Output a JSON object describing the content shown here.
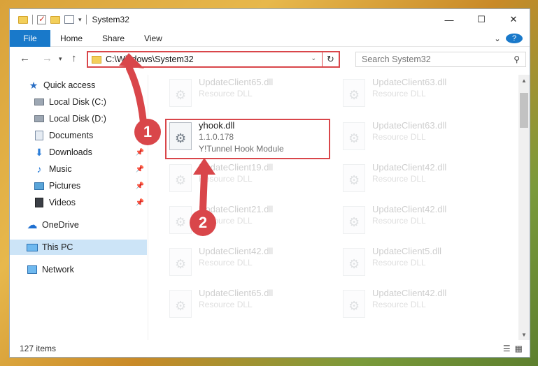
{
  "window": {
    "title": "System32"
  },
  "ribbon": {
    "tabs": [
      "File",
      "Home",
      "Share",
      "View"
    ]
  },
  "address": {
    "path": "C:\\Windows\\System32"
  },
  "search": {
    "placeholder": "Search System32"
  },
  "sidebar": {
    "items": [
      {
        "label": "Quick access",
        "icon": "star-icon"
      },
      {
        "label": "Local Disk (C:)",
        "icon": "drive-icon"
      },
      {
        "label": "Local Disk (D:)",
        "icon": "drive-icon"
      },
      {
        "label": "Documents",
        "icon": "documents-icon"
      },
      {
        "label": "Downloads",
        "icon": "download-icon",
        "pinned": true
      },
      {
        "label": "Music",
        "icon": "music-icon",
        "pinned": true
      },
      {
        "label": "Pictures",
        "icon": "pictures-icon",
        "pinned": true
      },
      {
        "label": "Videos",
        "icon": "videos-icon",
        "pinned": true
      },
      {
        "label": "OneDrive",
        "icon": "cloud-icon"
      },
      {
        "label": "This PC",
        "icon": "computer-icon",
        "selected": true
      },
      {
        "label": "Network",
        "icon": "network-icon"
      }
    ]
  },
  "files": {
    "left": [
      {
        "name": "UpdateClient65.dll",
        "type": "Resource DLL"
      },
      {
        "name": "yhook.dll",
        "version": "1.1.0.178",
        "description": "Y!Tunnel Hook Module"
      },
      {
        "name": "UpdateClient19.dll",
        "type": "Resource DLL"
      },
      {
        "name": "UpdateClient21.dll",
        "type": "Resource DLL"
      },
      {
        "name": "UpdateClient42.dll",
        "type": "Resource DLL"
      },
      {
        "name": "UpdateClient65.dll",
        "type": "Resource DLL"
      }
    ],
    "right": [
      {
        "name": "UpdateClient63.dll",
        "type": "Resource DLL"
      },
      {
        "name": "UpdateClient63.dll",
        "type": "Resource DLL"
      },
      {
        "name": "UpdateClient42.dll",
        "type": "Resource DLL"
      },
      {
        "name": "UpdateClient42.dll",
        "type": "Resource DLL"
      },
      {
        "name": "UpdateClient5.dll",
        "type": "Resource DLL"
      },
      {
        "name": "UpdateClient42.dll",
        "type": "Resource DLL"
      }
    ]
  },
  "status": {
    "item_count": "127 items"
  },
  "annotations": {
    "badge1": "1",
    "badge2": "2",
    "color": "#d9464a"
  },
  "colors": {
    "accent": "#1979ca",
    "selection": "#cce4f7"
  }
}
